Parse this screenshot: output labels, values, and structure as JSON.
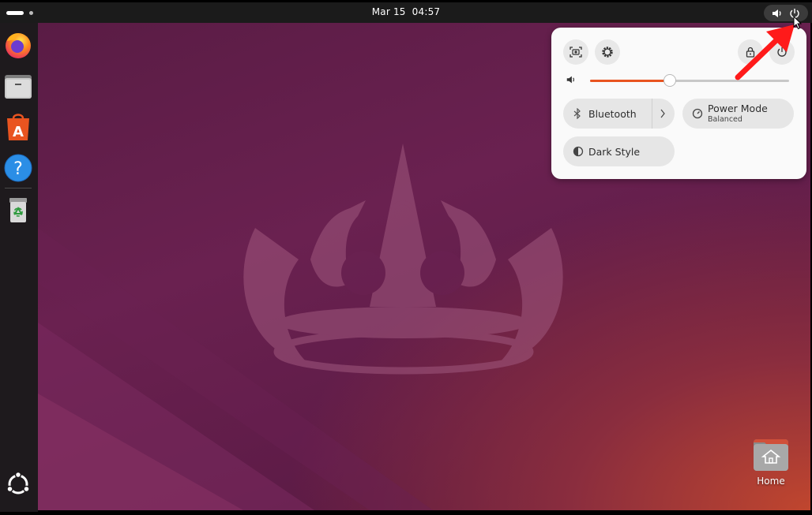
{
  "topbar": {
    "date": "Mar 15",
    "time": "04:57"
  },
  "dock": {
    "items": [
      {
        "name": "Firefox",
        "icon": "firefox-icon"
      },
      {
        "name": "Files",
        "icon": "files-icon"
      },
      {
        "name": "App Center",
        "icon": "app-center-icon"
      },
      {
        "name": "Help",
        "icon": "help-icon"
      },
      {
        "name": "Trash",
        "icon": "trash-icon"
      }
    ],
    "show_apps_icon": "ubuntu-logo-icon"
  },
  "desktop": {
    "home_label": "Home"
  },
  "quick_settings": {
    "volume_fraction": 0.4,
    "bluetooth_label": "Bluetooth",
    "power_mode_label": "Power Mode",
    "power_mode_value": "Balanced",
    "dark_style_label": "Dark Style"
  },
  "colors": {
    "accent": "#e95420",
    "annotation_arrow": "#ff1a1a"
  }
}
